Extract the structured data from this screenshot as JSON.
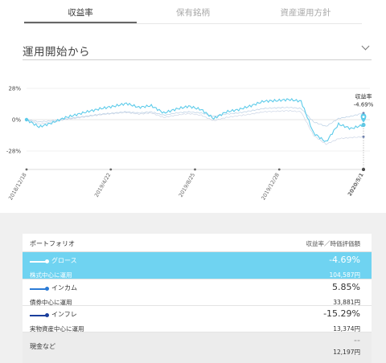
{
  "tabs": [
    {
      "label": "収益率",
      "active": true
    },
    {
      "label": "保有銘柄",
      "active": false
    },
    {
      "label": "資産運用方針",
      "active": false
    }
  ],
  "period_select": {
    "label": "運用開始から"
  },
  "chart_data": {
    "type": "line",
    "yticks": [
      "28%",
      "0%",
      "-28%"
    ],
    "ylim": [
      -28,
      28
    ],
    "xticks": [
      "2018/12/18",
      "2019/4/22",
      "2019/8/25",
      "2019/12/28",
      "2020/5/1"
    ],
    "tooltip": {
      "label": "収益率",
      "value": "-4.69%",
      "date": "2020/5/1"
    },
    "series": [
      {
        "name": "グロース",
        "color": "#5ccbea",
        "values": [
          0.0,
          -6.5,
          -3.0,
          1.5,
          4.5,
          7.5,
          10.0,
          12.0,
          14.5,
          11.0,
          12.5,
          6.0,
          9.5,
          12.0,
          9.0,
          1.0,
          7.0,
          9.0,
          12.5,
          16.5,
          17.0,
          18.0,
          16.5,
          -12.0,
          -20.0,
          -4.0,
          -8.0,
          -4.69
        ]
      },
      {
        "name": "インカム",
        "color": "#b9cfe4",
        "values": [
          0.0,
          -2.0,
          -1.0,
          0.5,
          2.0,
          3.5,
          5.0,
          6.0,
          7.0,
          6.0,
          7.0,
          4.0,
          6.0,
          7.0,
          6.0,
          3.0,
          5.0,
          6.0,
          8.0,
          10.0,
          10.5,
          11.0,
          10.0,
          -2.0,
          -6.0,
          1.0,
          3.0,
          5.85
        ]
      },
      {
        "name": "インフレ",
        "color": "#cdd6e6",
        "values": [
          0.0,
          -4.0,
          -2.5,
          0.0,
          1.5,
          3.0,
          4.5,
          5.5,
          6.5,
          5.0,
          6.0,
          2.0,
          4.0,
          5.5,
          4.0,
          -1.0,
          2.0,
          3.5,
          5.0,
          7.0,
          7.5,
          8.0,
          7.0,
          -14.0,
          -22.0,
          -17.0,
          -16.0,
          -15.29
        ]
      }
    ]
  },
  "portfolio": {
    "title": "ポートフォリオ",
    "header_right": "収益率／時価評価額",
    "rows": [
      {
        "name": "グロース",
        "sub": "株式中心に運用",
        "rate": "-4.69%",
        "value": "104,587円",
        "color": "#ffffff",
        "selected": true
      },
      {
        "name": "インカム",
        "sub": "債券中心に運用",
        "rate": "5.85%",
        "value": "33,881円",
        "color": "#2b7bd6",
        "selected": false
      },
      {
        "name": "インフレ",
        "sub": "実物資産中心に運用",
        "rate": "-15.29%",
        "value": "13,374円",
        "color": "#1a3f9c",
        "selected": false
      }
    ],
    "cash": {
      "name": "現金など",
      "rate": "--",
      "value": "12,197円"
    }
  }
}
